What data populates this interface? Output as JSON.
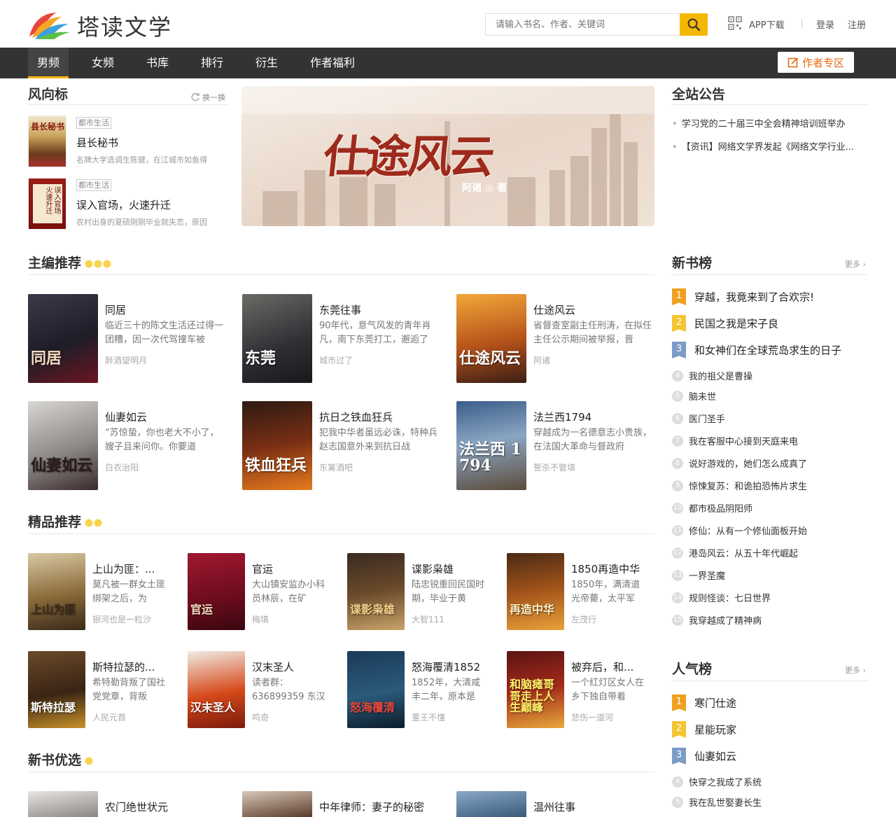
{
  "header": {
    "site_name": "塔读文学",
    "search_placeholder": "请输入书名、作者、关键词",
    "app_download": "APP下载",
    "login": "登录",
    "register": "注册"
  },
  "nav": {
    "items": [
      "男频",
      "女频",
      "书库",
      "排行",
      "衍生",
      "作者福利"
    ],
    "author_zone": "作者专区"
  },
  "wind_vane": {
    "title": "风向标",
    "refresh_label": "换一换",
    "items": [
      {
        "tag": "都市生活",
        "title": "县长秘书",
        "desc": "名牌大学选调生陈健，在江城市如鱼得",
        "cover_text": "县长秘书"
      },
      {
        "tag": "都市生活",
        "title": "误入官场，火速升迁",
        "desc": "农村出身的夏硕刚刚毕业就失恋，原因",
        "cover_text": "误入官场 火速升迁"
      }
    ]
  },
  "banner": {
    "title": "仕途风云",
    "author_line": "阿诸 ◎ 著"
  },
  "announcements": {
    "title": "全站公告",
    "items": [
      "学习党的二十届三中全会精神培训班举办",
      "【资讯】网络文学界发起《网络文学行业..."
    ]
  },
  "editor_picks": {
    "title": "主编推荐",
    "books": [
      {
        "title": "同居",
        "desc": "临近三十的陈文生活还过得一团糟，因一次代驾撞车被",
        "author": "醉酒望明月",
        "cover_text": "同居"
      },
      {
        "title": "东莞往事",
        "desc": "90年代，意气风发的青年肖凡，南下东莞打工，邂逅了",
        "author": "城市过了",
        "cover_text": "东莞"
      },
      {
        "title": "仕途风云",
        "desc": "省督查室副主任刑涛，在拟任主任公示期间被举报，晋",
        "author": "阿诸",
        "cover_text": "仕途风云"
      },
      {
        "title": "仙妻如云",
        "desc": "“苏惊蛰，你也老大不小了，嫂子且来问你。你要道",
        "author": "白衣治阳",
        "cover_text": "仙妻如云"
      },
      {
        "title": "抗日之铁血狂兵",
        "desc": "犯我中华者虽远必诛，特种兵赵志国意外来到抗日战",
        "author": "东篱酒吧",
        "cover_text": "铁血狂兵"
      },
      {
        "title": "法兰西1794",
        "desc": "穿越成为一名德意志小贵族，在法国大革命与督政府",
        "author": "誓杀不管填",
        "cover_text": "法兰西 1794"
      }
    ]
  },
  "quality_picks": {
    "title": "精品推荐",
    "books": [
      {
        "title": "上山为匪：...",
        "desc": "莫凡被一群女土匪绑架之后，为",
        "author": "银河也是一粒沙",
        "cover_text": "上山为匪"
      },
      {
        "title": "官运",
        "desc": "大山镇安监办小科员林辰，在矿",
        "author": "梅填",
        "cover_text": "官运"
      },
      {
        "title": "谍影枭雄",
        "desc": "陆忠锐重回民国时期，毕业于黄",
        "author": "大智111",
        "cover_text": "谍影枭雄"
      },
      {
        "title": "1850再造中华",
        "desc": "1850年，满清道光帝薨，太平军",
        "author": "左茂行",
        "cover_text": "再造中华"
      },
      {
        "title": "斯特拉瑟的...",
        "desc": "希特勒背叛了国社党党章，背叛",
        "author": "人民元首",
        "cover_text": "斯特拉瑟"
      },
      {
        "title": "汉末圣人",
        "desc": "读者群：636899359 东汉",
        "author": "鸣奇",
        "cover_text": "汉末圣人"
      },
      {
        "title": "怒海覆清1852",
        "desc": "1852年，大清咸丰二年，原本是",
        "author": "董王不懂",
        "cover_text": "怒海覆清"
      },
      {
        "title": "被弃后，和...",
        "desc": "一个红灯区女人在乡下独自带着",
        "author": "悲伤一道河",
        "cover_text": "和脑瘫哥哥走上人生巅峰"
      }
    ]
  },
  "new_picks": {
    "title": "新书优选",
    "books": [
      {
        "title": "农门绝世状元"
      },
      {
        "title": "中年律师：妻子的秘密"
      },
      {
        "title": "温州往事"
      }
    ]
  },
  "new_rank": {
    "title": "新书榜",
    "more": "更多",
    "items": [
      "穿越，我竟来到了合欢宗!",
      "民国之我是宋子良",
      "和女神们在全球荒岛求生的日子",
      "我的祖父是曹操",
      "脑未世",
      "医门圣手",
      "我在客服中心接到天庭来电",
      "说好游戏的，她们怎么成真了",
      "惊悚复苏：和诡拍恐怖片求生",
      "都市极品阴阳师",
      "修仙：从有一个修仙面板开始",
      "港岛风云：从五十年代崛起",
      "一界圣魔",
      "规则怪谈：七日世界",
      "我穿越成了精神病"
    ]
  },
  "popular_rank": {
    "title": "人气榜",
    "more": "更多",
    "items": [
      "寒门仕途",
      "星能玩家",
      "仙妻如云",
      "快穿之我成了系统",
      "我在乱世娶妻长生"
    ]
  },
  "colors": {
    "accent": "#f5b800",
    "nav_bg": "#333333",
    "author_zone": "#e36b1a",
    "rank1": "#f0a020",
    "rank2": "#f5c430",
    "rank3": "#7a9cc6"
  }
}
